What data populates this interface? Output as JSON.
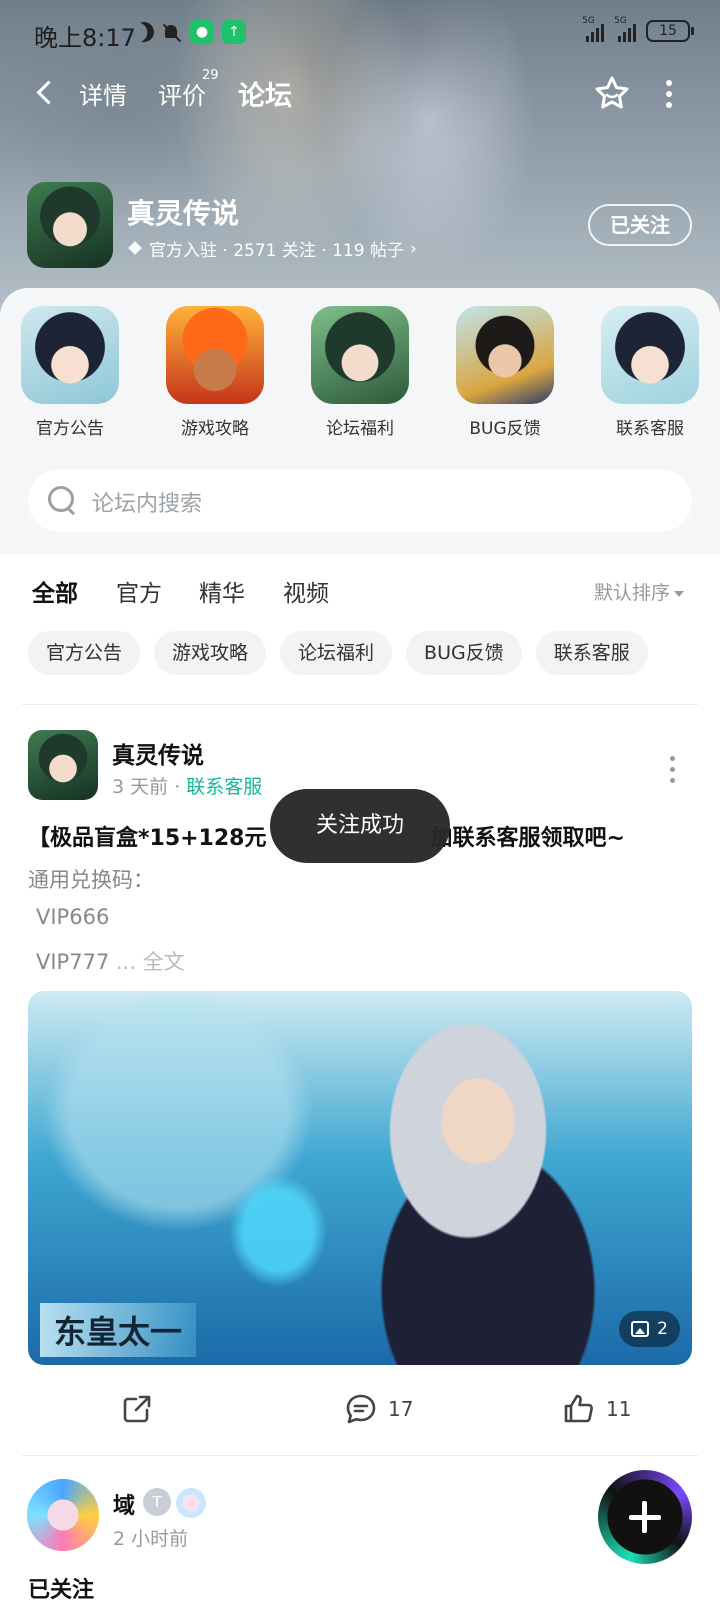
{
  "status_bar": {
    "time": "晚上8:17",
    "signal1_label": "5G",
    "signal2_label": "5G",
    "battery": "15"
  },
  "nav": {
    "tabs": [
      {
        "label": "详情"
      },
      {
        "label": "评价",
        "badge": "29"
      },
      {
        "label": "论坛",
        "active": true
      }
    ]
  },
  "game": {
    "name": "真灵传说",
    "meta": "官方入驻 · 2571 关注 · 119 帖子",
    "follow_label": "已关注"
  },
  "categories": [
    {
      "label": "官方公告",
      "icon": "game-character-avatar"
    },
    {
      "label": "游戏攻略",
      "icon": "fire-hero-avatar"
    },
    {
      "label": "论坛福利",
      "icon": "green-heroine-avatar"
    },
    {
      "label": "BUG反馈",
      "icon": "swordsman-avatar"
    },
    {
      "label": "联系客服",
      "icon": "game-character-avatar"
    }
  ],
  "search": {
    "placeholder": "论坛内搜索"
  },
  "feed_tabs": [
    {
      "label": "全部",
      "active": true
    },
    {
      "label": "官方"
    },
    {
      "label": "精华"
    },
    {
      "label": "视频"
    }
  ],
  "sort_label": "默认排序",
  "chips": [
    "官方公告",
    "游戏攻略",
    "论坛福利",
    "BUG反馈",
    "联系客服"
  ],
  "post1": {
    "author": "真灵传说",
    "time": "3 天前",
    "tag": "联系客服",
    "title_left": "【极品盲盒*15+128元",
    "title_right": "加联系客服领取吧~",
    "line1": "通用兑换码：",
    "line2": "VIP666",
    "line3": "VIP777",
    "line3_more": " ... 全文",
    "image_caption": "东皇太一",
    "image_count": "2",
    "share_label": "",
    "comments": "17",
    "likes": "11"
  },
  "toast": "关注成功",
  "post2": {
    "author": "域",
    "badge": "T",
    "time": "2 小时前",
    "text": "已关注"
  },
  "colors": {
    "accent": "#13c6a6",
    "tag": "#13b89a"
  }
}
